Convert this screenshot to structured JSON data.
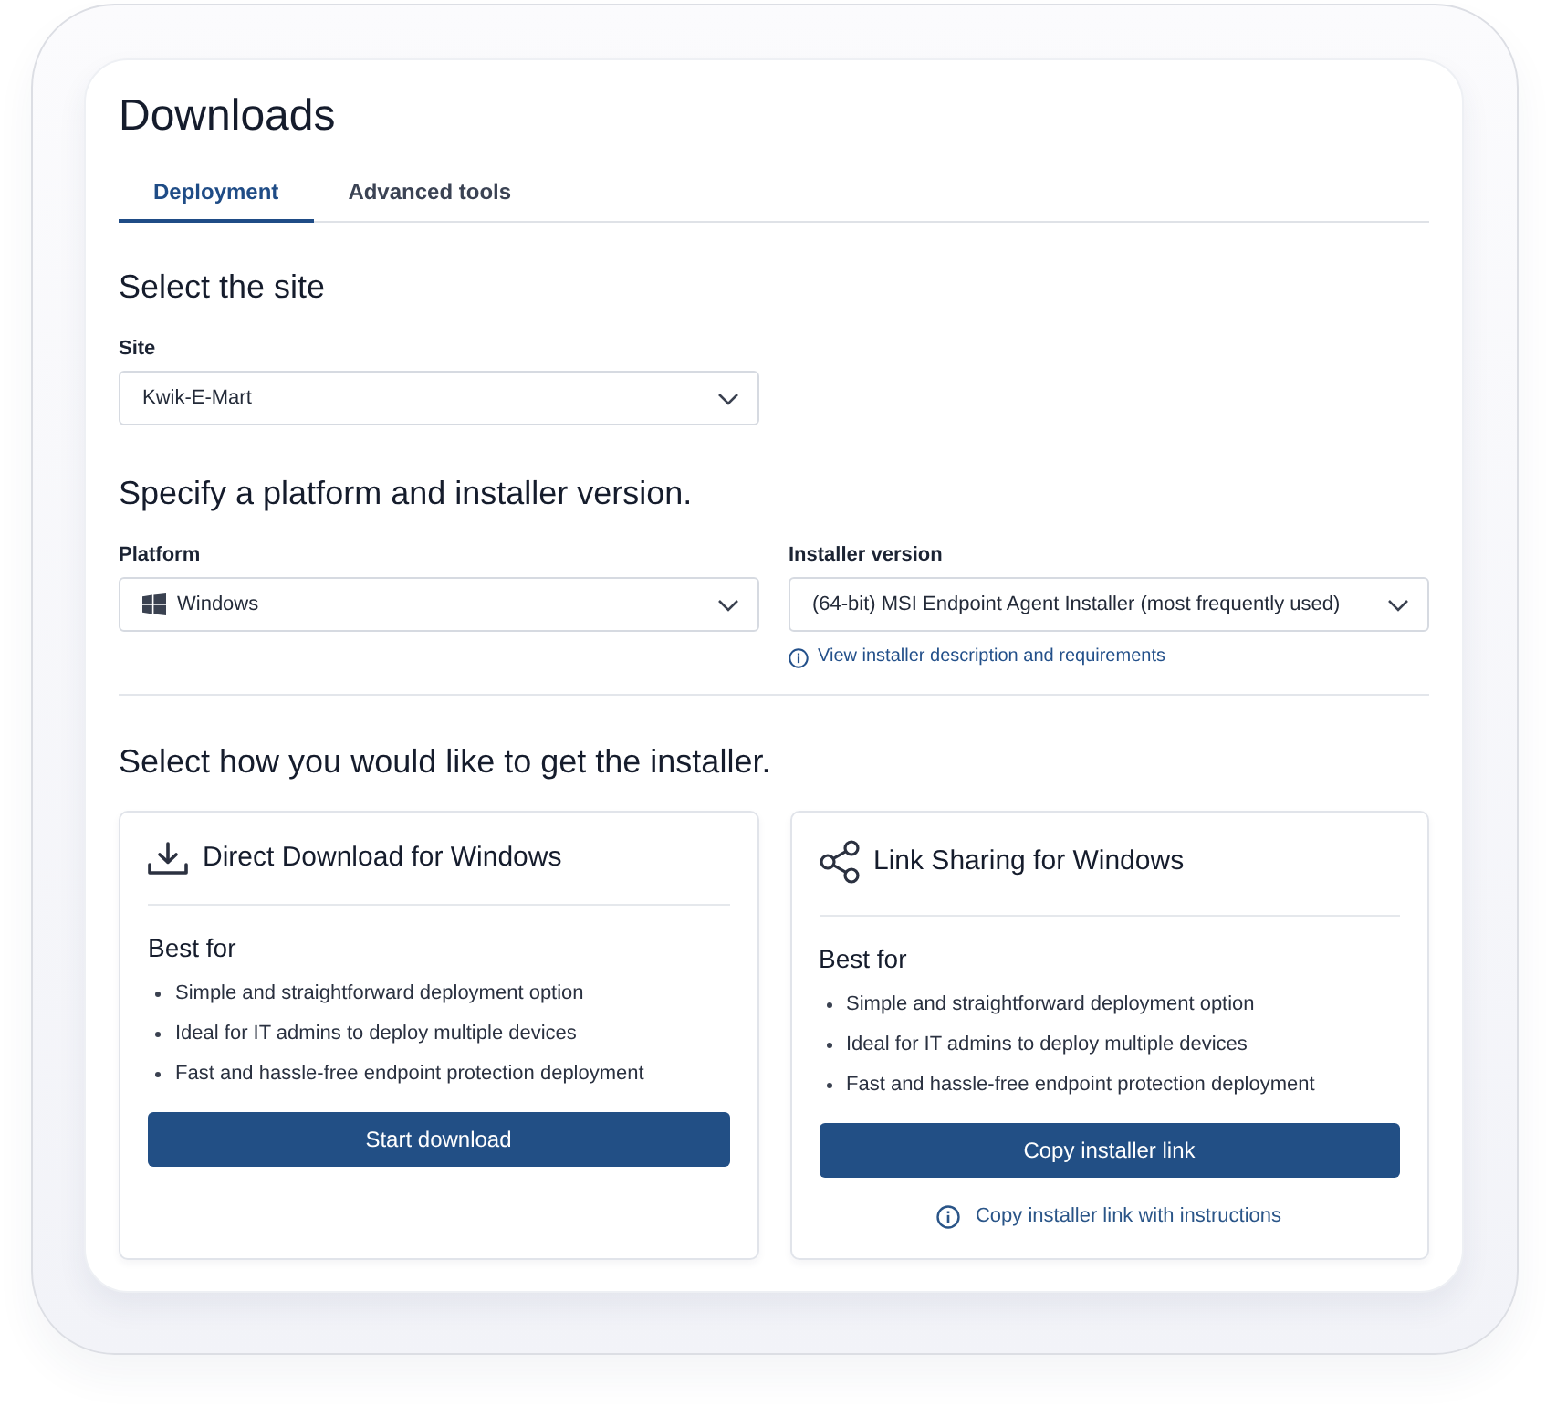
{
  "page": {
    "title": "Downloads"
  },
  "tabs": [
    {
      "label": "Deployment",
      "selected": true
    },
    {
      "label": "Advanced tools",
      "selected": false
    }
  ],
  "site_section": {
    "heading": "Select the site",
    "site_field": {
      "label": "Site",
      "value": "Kwik-E-Mart"
    }
  },
  "platform_section": {
    "heading": "Specify a platform and installer version.",
    "platform_field": {
      "label": "Platform",
      "value": "Windows"
    },
    "installer_field": {
      "label": "Installer version",
      "value": "(64-bit) MSI Endpoint Agent Installer (most frequently used)"
    },
    "info_link": "View installer description and requirements"
  },
  "method_section": {
    "heading": "Select how you would like to get the installer.",
    "options": [
      {
        "kind": "download",
        "title": "Direct Download for Windows",
        "subheading": "Best for",
        "points": [
          "Simple and straightforward deployment option",
          "Ideal for IT admins to deploy multiple devices",
          "Fast and hassle-free endpoint protection deployment"
        ],
        "button": "Start download"
      },
      {
        "kind": "share",
        "title": "Link Sharing for Windows",
        "subheading": "Best for",
        "points": [
          "Simple and straightforward deployment option",
          "Ideal for IT admins to deploy multiple devices",
          "Fast and hassle-free endpoint protection deployment"
        ],
        "button": "Copy installer link",
        "link": "Copy installer link with instructions"
      }
    ]
  }
}
